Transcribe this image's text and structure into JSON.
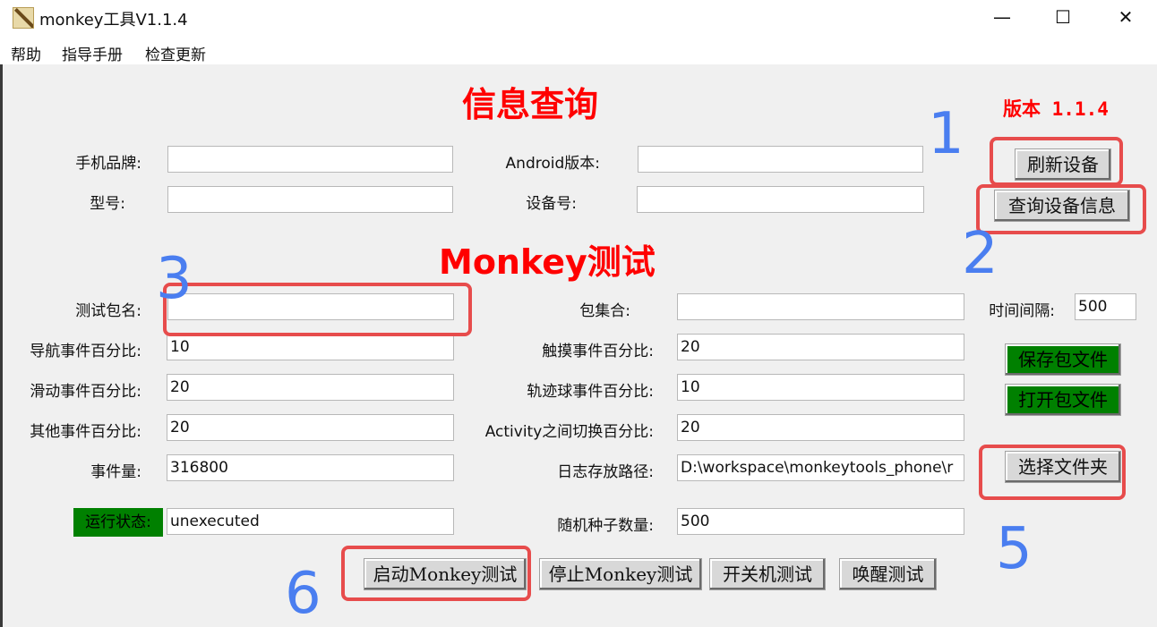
{
  "window": {
    "title": "monkey工具V1.1.4",
    "minimize": "—",
    "maximize": "☐",
    "close": "✕"
  },
  "menu": [
    "帮助",
    "指导手册",
    "检查更新"
  ],
  "info": {
    "heading": "信息查询",
    "version": "版本 1.1.4",
    "brand_label": "手机品牌:",
    "brand_value": "",
    "android_label": "Android版本:",
    "android_value": "",
    "model_label": "型号:",
    "model_value": "",
    "device_label": "设备号:",
    "device_value": "",
    "refresh_button": "刷新设备",
    "query_button": "查询设备信息"
  },
  "monkey": {
    "heading": "Monkey测试",
    "package_label": "测试包名:",
    "package_value": "",
    "package_set_label": "包集合:",
    "package_set_value": "",
    "interval_label": "时间间隔:",
    "interval_value": "500",
    "nav_label": "导航事件百分比:",
    "nav_value": "10",
    "touch_label": "触摸事件百分比:",
    "touch_value": "20",
    "slide_label": "滑动事件百分比:",
    "slide_value": "20",
    "trackball_label": "轨迹球事件百分比:",
    "trackball_value": "10",
    "other_label": "其他事件百分比:",
    "other_value": "20",
    "activity_label": "Activity之间切换百分比:",
    "activity_value": "20",
    "count_label": "事件量:",
    "count_value": "316800",
    "log_label": "日志存放路径:",
    "log_value": "D:\\workspace\\monkeytools_phone\\r",
    "status_label": "运行状态:",
    "status_value": "unexecuted",
    "seed_label": "随机种子数量:",
    "seed_value": "500",
    "save_button": "保存包文件",
    "open_button": "打开包文件",
    "folder_button": "选择文件夹",
    "start_button": "启动Monkey测试",
    "stop_button": "停止Monkey测试",
    "power_button": "开关机测试",
    "wake_button": "唤醒测试"
  },
  "annotations": [
    "1",
    "2",
    "3",
    "5",
    "6"
  ],
  "colors": {
    "heading": "#ff0000",
    "annotation_box": "#e74c4c",
    "annotation_number": "#4a7ef0",
    "green_button": "#008000"
  }
}
